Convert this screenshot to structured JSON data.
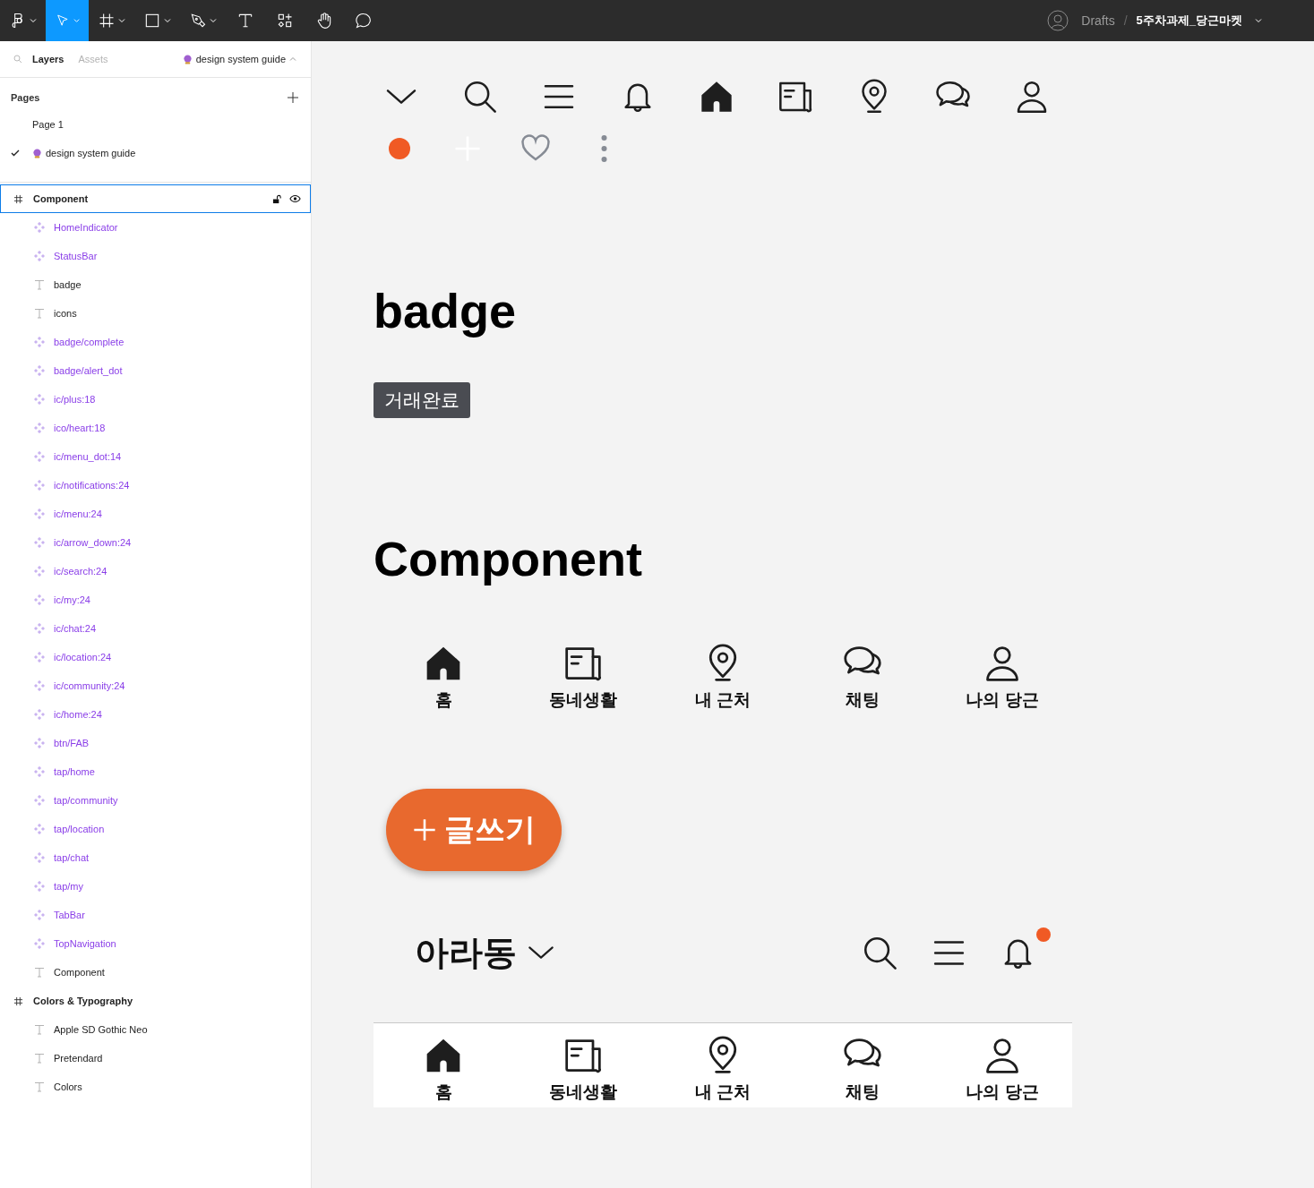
{
  "toolbar": {
    "tools": [
      {
        "kind": "logo",
        "has_menu": true,
        "selected": false
      },
      {
        "kind": "move",
        "has_menu": true,
        "selected": true
      },
      {
        "kind": "frame",
        "has_menu": true,
        "selected": false
      },
      {
        "kind": "shape",
        "has_menu": true,
        "selected": false
      },
      {
        "kind": "pen",
        "has_menu": true,
        "selected": false
      },
      {
        "kind": "text",
        "has_menu": false,
        "selected": false
      },
      {
        "kind": "resources",
        "has_menu": false,
        "selected": false
      },
      {
        "kind": "hand",
        "has_menu": false,
        "selected": false
      },
      {
        "kind": "comment",
        "has_menu": false,
        "selected": false
      }
    ],
    "breadcrumb": {
      "folder": "Drafts",
      "separator": "/",
      "file": "5주차과제_당근마켓"
    }
  },
  "sidebar": {
    "tabs": [
      {
        "label": "Layers",
        "selected": true
      },
      {
        "label": "Assets",
        "selected": false
      }
    ],
    "page_switcher": "design system guide",
    "pages_title": "Pages",
    "pages": [
      {
        "label": "Page 1",
        "crystal_ball": false,
        "selected": false
      },
      {
        "label": "design system guide",
        "crystal_ball": true,
        "selected": true
      }
    ],
    "layers": [
      {
        "label": "Component",
        "selected": true,
        "children": [
          {
            "label": "HomeIndicator",
            "kind": "component"
          },
          {
            "label": "StatusBar",
            "kind": "component"
          },
          {
            "label": "badge",
            "kind": "text"
          },
          {
            "label": "icons",
            "kind": "text"
          },
          {
            "label": "badge/complete",
            "kind": "component"
          },
          {
            "label": "badge/alert_dot",
            "kind": "component"
          },
          {
            "label": "ic/plus:18",
            "kind": "component"
          },
          {
            "label": "ico/heart:18",
            "kind": "component"
          },
          {
            "label": "ic/menu_dot:14",
            "kind": "component"
          },
          {
            "label": "ic/notifications:24",
            "kind": "component"
          },
          {
            "label": "ic/menu:24",
            "kind": "component"
          },
          {
            "label": "ic/arrow_down:24",
            "kind": "component"
          },
          {
            "label": "ic/search:24",
            "kind": "component"
          },
          {
            "label": "ic/my:24",
            "kind": "component"
          },
          {
            "label": "ic/chat:24",
            "kind": "component"
          },
          {
            "label": "ic/location:24",
            "kind": "component"
          },
          {
            "label": "ic/community:24",
            "kind": "component"
          },
          {
            "label": "ic/home:24",
            "kind": "component"
          },
          {
            "label": "btn/FAB",
            "kind": "component"
          },
          {
            "label": "tap/home",
            "kind": "component"
          },
          {
            "label": "tap/community",
            "kind": "component"
          },
          {
            "label": "tap/location",
            "kind": "component"
          },
          {
            "label": "tap/chat",
            "kind": "component"
          },
          {
            "label": "tap/my",
            "kind": "component"
          },
          {
            "label": "TabBar",
            "kind": "component"
          },
          {
            "label": "TopNavigation",
            "kind": "component"
          },
          {
            "label": "Component",
            "kind": "text"
          }
        ]
      },
      {
        "label": "Colors & Typography",
        "selected": false,
        "children": [
          {
            "label": "Apple SD Gothic Neo",
            "kind": "text"
          },
          {
            "label": "Pretendard",
            "kind": "text"
          },
          {
            "label": "Colors",
            "kind": "text"
          }
        ]
      }
    ]
  },
  "canvas": {
    "badge_title": "badge",
    "badge": "거래완료",
    "component_title": "Component",
    "tabs": [
      {
        "label": "홈"
      },
      {
        "label": "동네생활"
      },
      {
        "label": "내 근처"
      },
      {
        "label": "채팅"
      },
      {
        "label": "나의 당근"
      }
    ],
    "fab": {
      "label": "글쓰기"
    },
    "top_nav": {
      "location": "아라동",
      "alert": true
    },
    "tab_bar": [
      {
        "label": "홈"
      },
      {
        "label": "동네생활"
      },
      {
        "label": "내 근처"
      },
      {
        "label": "채팅"
      },
      {
        "label": "나의 당근"
      }
    ]
  }
}
